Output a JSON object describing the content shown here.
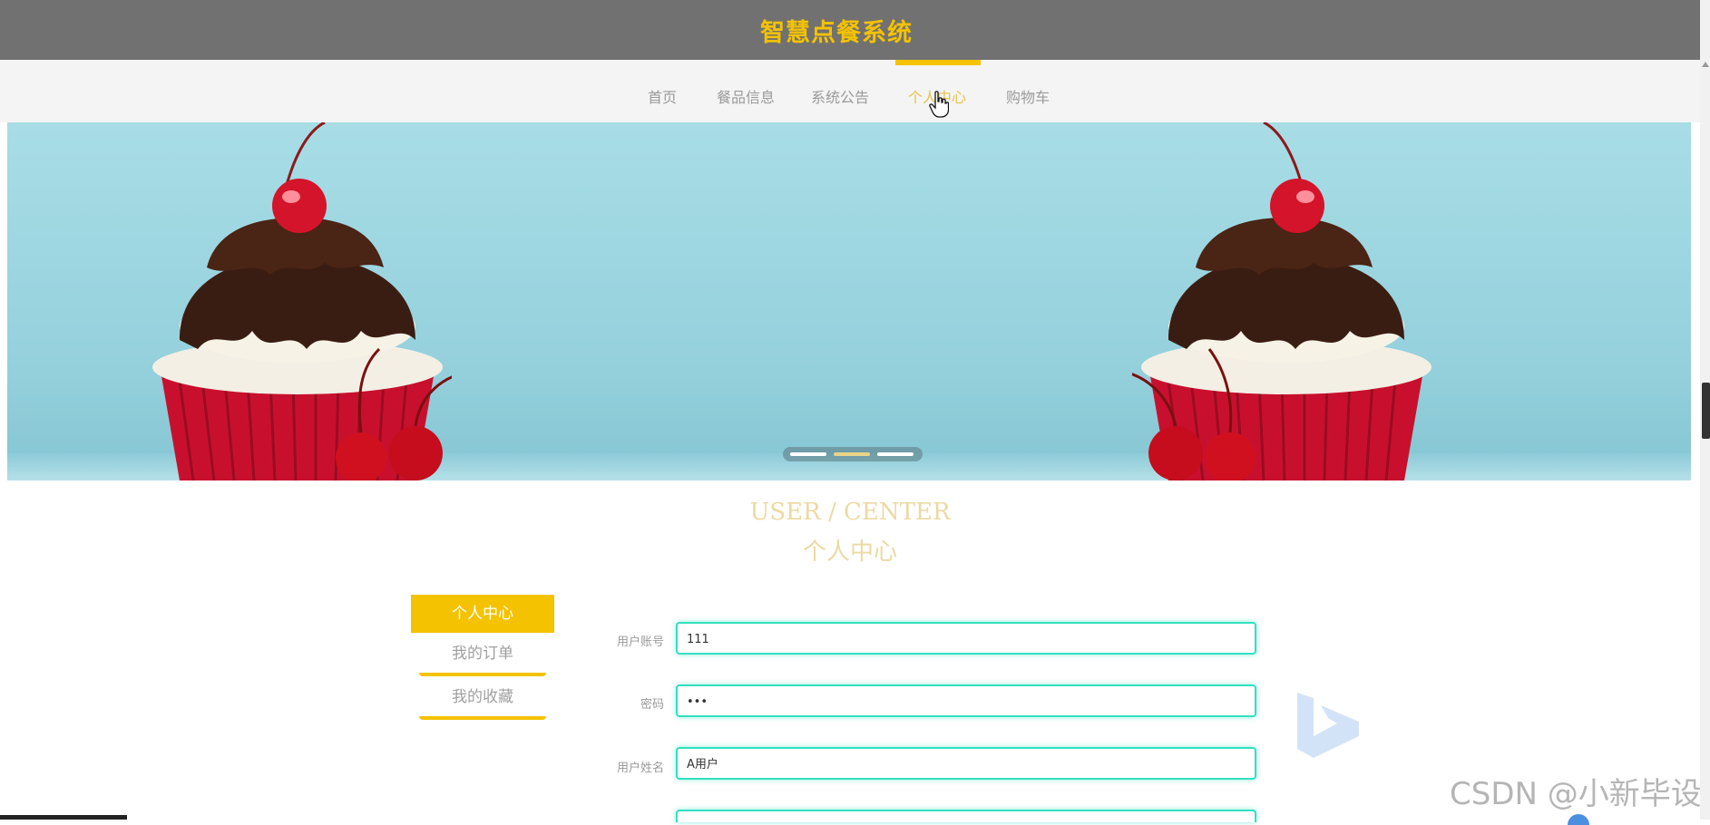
{
  "header": {
    "title": "智慧点餐系统"
  },
  "nav": {
    "items": [
      {
        "label": "首页"
      },
      {
        "label": "餐品信息"
      },
      {
        "label": "系统公告"
      },
      {
        "label": "个人中心"
      },
      {
        "label": "购物车"
      }
    ],
    "active": "个人中心"
  },
  "banner": {
    "slides": 3,
    "active_slide": 2
  },
  "section": {
    "title_en": "USER / CENTER",
    "title_cn": "个人中心"
  },
  "sidebar": {
    "items": [
      {
        "label": "个人中心"
      },
      {
        "label": "我的订单"
      },
      {
        "label": "我的收藏"
      }
    ]
  },
  "form": {
    "account_label": "用户账号",
    "account_value": "111",
    "password_label": "密码",
    "password_value": "•••",
    "name_label": "用户姓名",
    "name_value": "A用户"
  },
  "watermark": "CSDN @小新毕设",
  "colors": {
    "accent": "#f5c200",
    "header_bg": "#717171",
    "input_border": "#33e0c0"
  }
}
